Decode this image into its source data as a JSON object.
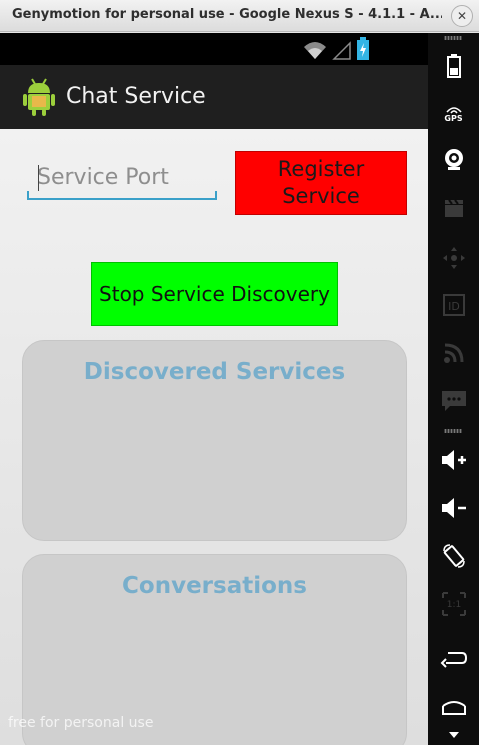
{
  "window": {
    "title": "Genymotion for personal use - Google Nexus S - 4.1.1 - A...",
    "close_glyph": "✕"
  },
  "statusbar": {
    "icons": [
      "wifi-icon",
      "signal-icon",
      "battery-charging-icon"
    ]
  },
  "actionbar": {
    "app_title": "Chat Service",
    "app_icon": "android-icon"
  },
  "form": {
    "port_placeholder": "Service Port",
    "port_value": "",
    "register_label": "Register Service",
    "stop_discovery_label": "Stop Service Discovery"
  },
  "panels": {
    "discovered_title": "Discovered Services",
    "conversations_title": "Conversations"
  },
  "watermark": "free for personal use",
  "sidebar": {
    "gps_label": "GPS",
    "id_label": "ID",
    "ratio_label": "1:1",
    "items": [
      "battery-icon",
      "gps-icon",
      "camera-icon",
      "video-clapper-icon",
      "dpad-icon",
      "id-icon",
      "rss-icon",
      "sms-icon",
      "volume-up-icon",
      "volume-down-icon",
      "rotate-icon",
      "scale-icon",
      "back-icon",
      "home-icon",
      "menu-icon"
    ]
  },
  "colors": {
    "register_bg": "#ff0000",
    "stop_bg": "#00ff00",
    "panel_bg": "#d0d0d0",
    "panel_title": "#78aecb",
    "input_underline": "#3aa0c9"
  }
}
